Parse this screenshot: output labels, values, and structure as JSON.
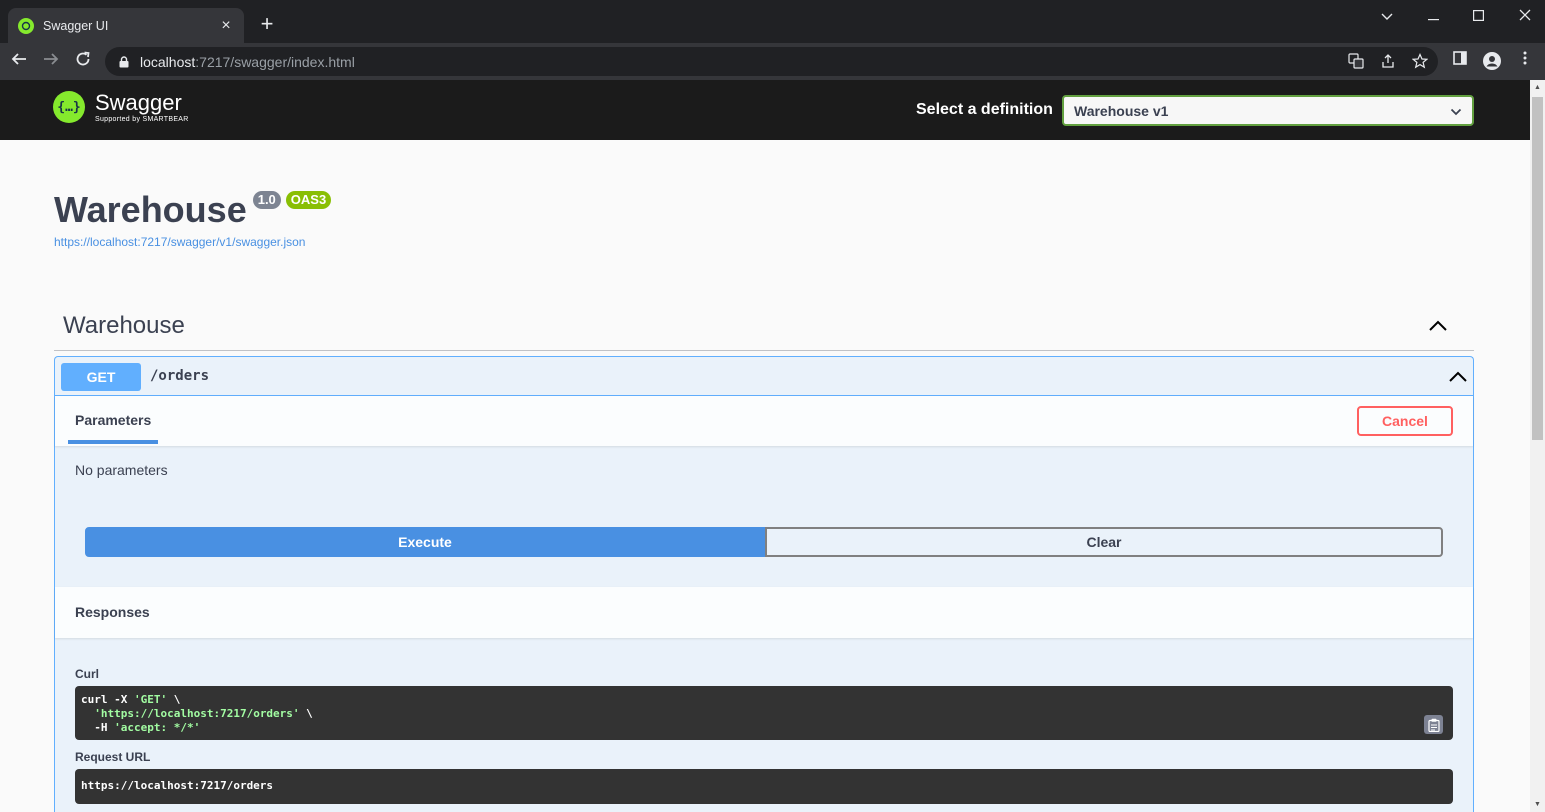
{
  "browser": {
    "tab_title": "Swagger UI",
    "url_host": "localhost",
    "url_rest": ":7217/swagger/index.html"
  },
  "topbar": {
    "brand_name": "Swagger",
    "brand_sub": "Supported by SMARTBEAR",
    "select_label": "Select a definition",
    "selected_definition": "Warehouse v1"
  },
  "info": {
    "title": "Warehouse",
    "version": "1.0",
    "oas": "OAS3",
    "spec_url": "https://localhost:7217/swagger/v1/swagger.json"
  },
  "tag": {
    "name": "Warehouse"
  },
  "operation": {
    "method": "GET",
    "path": "/orders",
    "params_tab": "Parameters",
    "cancel_label": "Cancel",
    "no_params": "No parameters",
    "execute_label": "Execute",
    "clear_label": "Clear",
    "responses_title": "Responses",
    "curl_label": "Curl",
    "curl": {
      "line1_cmd": "curl -X ",
      "line1_str": "'GET'",
      "line1_end": " \\",
      "line2_str": "'https://localhost:7217/orders'",
      "line2_end": " \\",
      "line3_cmd": "-H ",
      "line3_str": "'accept: */*'"
    },
    "request_url_label": "Request URL",
    "request_url": "https://localhost:7217/orders"
  },
  "colors": {
    "get_method": "#61affe",
    "execute": "#4990e2",
    "cancel": "#ff6060",
    "oas_badge": "#89bf04",
    "brand_green": "#85ea2d"
  }
}
